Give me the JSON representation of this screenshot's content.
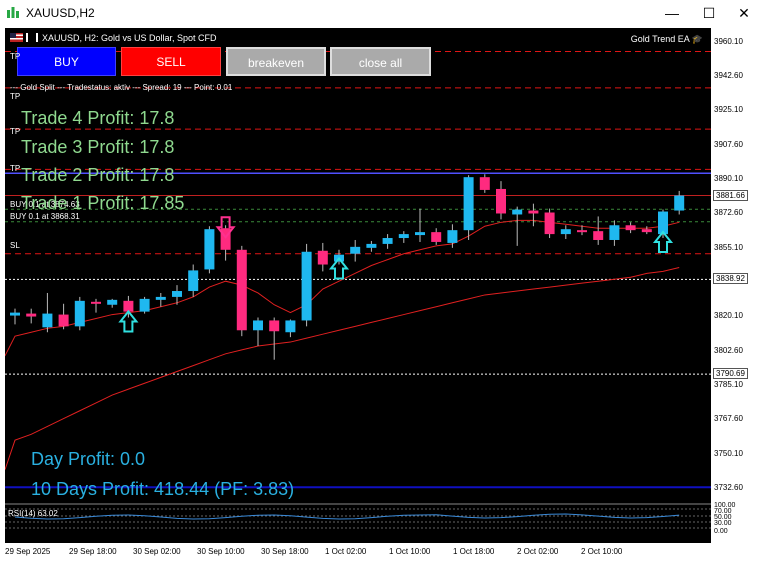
{
  "window": {
    "title": "XAUUSD,H2",
    "minimize": "—",
    "maximize": "☐",
    "close": "✕"
  },
  "chart": {
    "symbol_line": "XAUUSD, H2:  Gold vs US Dollar, Spot CFD",
    "ea_name": "Gold Trend EA",
    "status_line": "--- Gold Split --- Tradestatus: aktiv --- Spread: 19 --- Point: 0.01",
    "buttons": {
      "buy": "BUY",
      "sell": "SELL",
      "breakeven": "breakeven",
      "close_all": "close all"
    },
    "tags": {
      "tp": "TP",
      "sl": "SL",
      "buy1": "BUY 0.1 at 3874.63",
      "buy2": "BUY 0.1 at 3868.31"
    },
    "trade_profits": [
      "Trade 4 Profit: 17.8",
      "Trade 3 Profit: 17.8",
      "Trade 2 Profit: 17.8",
      "Trade 1 Profit: 17.85"
    ],
    "day_profit": "Day Profit: 0.0",
    "ten_day_profit": "10 Days Profit: 418.44 (PF: 3.83)",
    "rsi_label": "RSI(14) 63.02",
    "colors": {
      "bull": "#1fb8f0",
      "bear": "#ff2a7f",
      "ma": "#e02020",
      "buy": "#0000ff",
      "sell": "#ff0000"
    }
  },
  "price_scale": {
    "labels": [
      "3960.10",
      "3942.60",
      "3925.10",
      "3907.60",
      "3890.10",
      "3872.60",
      "3855.10",
      "3820.10",
      "3802.60",
      "3785.10",
      "3767.60",
      "3750.10",
      "3732.60"
    ],
    "current_price": "3881.66",
    "line_price": "3838.92",
    "line_price2": "3790.69",
    "rsi_labels": [
      "100.00",
      "70.00",
      "50.00",
      "30.00",
      "0.00"
    ]
  },
  "time_scale": {
    "labels": [
      "29 Sep 2025",
      "29 Sep 18:00",
      "30 Sep 02:00",
      "30 Sep 10:00",
      "30 Sep 18:00",
      "1 Oct 02:00",
      "1 Oct 10:00",
      "1 Oct 18:00",
      "2 Oct 02:00",
      "2 Oct 10:00"
    ]
  },
  "chart_data": {
    "type": "candlestick",
    "candles": [
      {
        "o": 3820.5,
        "h": 3824.0,
        "l": 3816.0,
        "c": 3822.0
      },
      {
        "o": 3821.5,
        "h": 3824.0,
        "l": 3816.5,
        "c": 3820.0
      },
      {
        "o": 3814.5,
        "h": 3832.0,
        "l": 3812.0,
        "c": 3821.5
      },
      {
        "o": 3821.0,
        "h": 3826.5,
        "l": 3813.5,
        "c": 3815.0
      },
      {
        "o": 3815.0,
        "h": 3830.0,
        "l": 3813.0,
        "c": 3828.0
      },
      {
        "o": 3827.5,
        "h": 3829.0,
        "l": 3822.0,
        "c": 3826.5
      },
      {
        "o": 3826.0,
        "h": 3829.0,
        "l": 3824.5,
        "c": 3828.5
      },
      {
        "o": 3828.0,
        "h": 3830.5,
        "l": 3819.5,
        "c": 3822.5
      },
      {
        "o": 3822.5,
        "h": 3830.0,
        "l": 3821.5,
        "c": 3829.0
      },
      {
        "o": 3828.5,
        "h": 3832.0,
        "l": 3825.0,
        "c": 3830.0
      },
      {
        "o": 3830.0,
        "h": 3836.0,
        "l": 3826.0,
        "c": 3833.0
      },
      {
        "o": 3833.0,
        "h": 3846.5,
        "l": 3830.0,
        "c": 3843.5
      },
      {
        "o": 3844.0,
        "h": 3866.0,
        "l": 3842.0,
        "c": 3864.5
      },
      {
        "o": 3865.0,
        "h": 3866.5,
        "l": 3848.5,
        "c": 3854.0
      },
      {
        "o": 3854.0,
        "h": 3856.0,
        "l": 3810.0,
        "c": 3813.0
      },
      {
        "o": 3813.0,
        "h": 3819.5,
        "l": 3805.0,
        "c": 3818.0
      },
      {
        "o": 3818.0,
        "h": 3819.5,
        "l": 3798.0,
        "c": 3812.5
      },
      {
        "o": 3812.0,
        "h": 3818.5,
        "l": 3809.5,
        "c": 3818.0
      },
      {
        "o": 3818.0,
        "h": 3857.0,
        "l": 3815.0,
        "c": 3853.0
      },
      {
        "o": 3853.5,
        "h": 3857.5,
        "l": 3843.0,
        "c": 3846.5
      },
      {
        "o": 3848.0,
        "h": 3854.0,
        "l": 3846.5,
        "c": 3851.5
      },
      {
        "o": 3852.0,
        "h": 3859.0,
        "l": 3848.0,
        "c": 3855.5
      },
      {
        "o": 3855.0,
        "h": 3858.5,
        "l": 3853.0,
        "c": 3857.0
      },
      {
        "o": 3857.0,
        "h": 3862.0,
        "l": 3854.5,
        "c": 3860.0
      },
      {
        "o": 3860.0,
        "h": 3863.5,
        "l": 3857.5,
        "c": 3862.0
      },
      {
        "o": 3861.5,
        "h": 3875.0,
        "l": 3858.0,
        "c": 3863.0
      },
      {
        "o": 3863.0,
        "h": 3865.0,
        "l": 3856.5,
        "c": 3858.0
      },
      {
        "o": 3857.5,
        "h": 3867.0,
        "l": 3855.0,
        "c": 3864.0
      },
      {
        "o": 3864.0,
        "h": 3892.0,
        "l": 3859.0,
        "c": 3891.0
      },
      {
        "o": 3891.0,
        "h": 3892.5,
        "l": 3883.0,
        "c": 3884.5
      },
      {
        "o": 3885.0,
        "h": 3889.0,
        "l": 3869.5,
        "c": 3872.5
      },
      {
        "o": 3872.0,
        "h": 3876.0,
        "l": 3856.0,
        "c": 3874.5
      },
      {
        "o": 3874.0,
        "h": 3877.5,
        "l": 3866.0,
        "c": 3872.5
      },
      {
        "o": 3873.0,
        "h": 3875.0,
        "l": 3860.0,
        "c": 3862.0
      },
      {
        "o": 3862.0,
        "h": 3866.5,
        "l": 3859.5,
        "c": 3864.5
      },
      {
        "o": 3864.0,
        "h": 3866.5,
        "l": 3861.5,
        "c": 3863.0
      },
      {
        "o": 3863.5,
        "h": 3871.0,
        "l": 3856.5,
        "c": 3859.0
      },
      {
        "o": 3859.0,
        "h": 3869.0,
        "l": 3856.0,
        "c": 3866.5
      },
      {
        "o": 3866.5,
        "h": 3868.0,
        "l": 3862.5,
        "c": 3864.0
      },
      {
        "o": 3864.5,
        "h": 3866.0,
        "l": 3862.0,
        "c": 3863.0
      },
      {
        "o": 3862.0,
        "h": 3874.5,
        "l": 3860.0,
        "c": 3873.5
      },
      {
        "o": 3874.0,
        "h": 3884.0,
        "l": 3872.0,
        "c": 3881.66
      }
    ],
    "ylim": [
      3725,
      3967
    ],
    "ma_fast": [
      3810,
      3812,
      3814,
      3815,
      3817,
      3819,
      3821,
      3822,
      3823,
      3825,
      3827,
      3830,
      3835,
      3838,
      3836,
      3832,
      3826,
      3822,
      3826,
      3834,
      3838,
      3842,
      3846,
      3849,
      3852,
      3854,
      3856,
      3857,
      3861,
      3866,
      3868,
      3869,
      3869,
      3868,
      3867,
      3866,
      3865,
      3865,
      3865,
      3865,
      3866,
      3868
    ],
    "ma_slow": [
      3757,
      3760,
      3764,
      3768,
      3772,
      3776,
      3780,
      3783,
      3786,
      3789,
      3792,
      3795,
      3798,
      3801,
      3803,
      3805,
      3806,
      3807,
      3809,
      3811,
      3813,
      3815,
      3817,
      3819,
      3821,
      3823,
      3825,
      3827,
      3829,
      3831,
      3832,
      3833,
      3834,
      3835,
      3836,
      3837,
      3838,
      3839,
      3840,
      3842,
      3843,
      3845
    ],
    "levels": {
      "tp_lines": [
        3955.0,
        3936.5,
        3915.5,
        3895.0
      ],
      "blue_line": 3893.0,
      "price_line": 3881.66,
      "buy_entries": [
        3874.63,
        3868.31
      ],
      "sl_line": 3852.0,
      "dotted_line": 3838.92,
      "dotted_line2": 3790.69,
      "day_profit_line": 3733.0
    },
    "signals": [
      {
        "index": 7,
        "dir": "up"
      },
      {
        "index": 13,
        "dir": "down"
      },
      {
        "index": 20,
        "dir": "up"
      },
      {
        "index": 40,
        "dir": "up"
      }
    ]
  }
}
